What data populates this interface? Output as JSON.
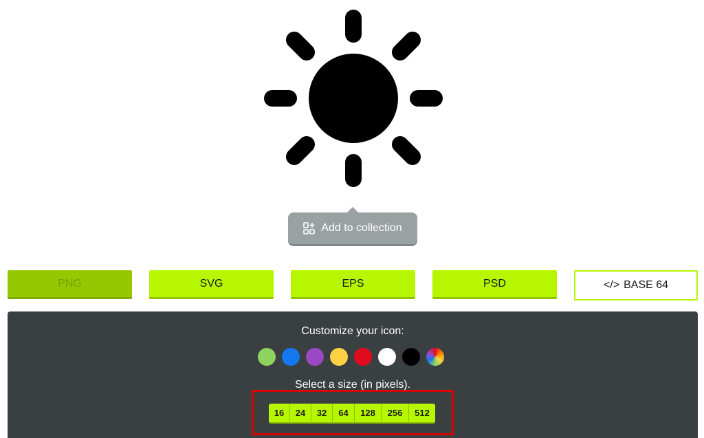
{
  "icon": {
    "name": "sun-icon"
  },
  "collection": {
    "label": "Add to collection",
    "icon": "add-to-collection-icon"
  },
  "formats": [
    {
      "label": "PNG",
      "state": "selected"
    },
    {
      "label": "SVG",
      "state": "normal"
    },
    {
      "label": "EPS",
      "state": "normal"
    },
    {
      "label": "PSD",
      "state": "normal"
    },
    {
      "label": "BASE 64",
      "prefix": "</>",
      "state": "outline"
    }
  ],
  "customize": {
    "title": "Customize your icon:",
    "colors": [
      "#8fd35f",
      "#1479f0",
      "#9c48c4",
      "#ffd145",
      "#e00b1d",
      "#ffffff",
      "#000000",
      "multicolor"
    ],
    "size_title": "Select a size (in pixels).",
    "sizes": [
      "16",
      "24",
      "32",
      "64",
      "128",
      "256",
      "512"
    ]
  },
  "accent_color": "#b6f700"
}
